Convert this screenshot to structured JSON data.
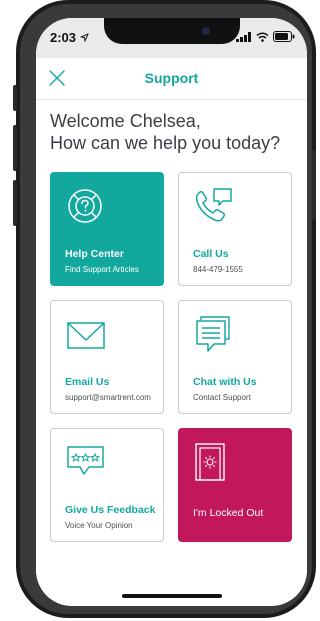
{
  "status_bar": {
    "time": "2:03"
  },
  "header": {
    "title": "Support",
    "close_icon": "close-icon"
  },
  "welcome": {
    "line1": "Welcome Chelsea,",
    "line2": "How can we help you today?"
  },
  "cards": [
    {
      "title": "Help Center",
      "subtitle": "Find Support Articles",
      "icon": "help-icon"
    },
    {
      "title": "Call Us",
      "subtitle": "844-479-1555",
      "icon": "phone-chat-icon"
    },
    {
      "title": "Email Us",
      "subtitle": "support@smartrent.com",
      "icon": "envelope-icon"
    },
    {
      "title": "Chat with Us",
      "subtitle": "Contact Support",
      "icon": "chat-icon"
    },
    {
      "title": "Give Us Feedback",
      "subtitle": "Voice Your Opinion",
      "icon": "feedback-icon"
    },
    {
      "title": "I'm Locked Out",
      "subtitle": "",
      "icon": "locked-door-icon"
    }
  ],
  "colors": {
    "accent": "#13a89e",
    "alert": "#c2185b"
  }
}
